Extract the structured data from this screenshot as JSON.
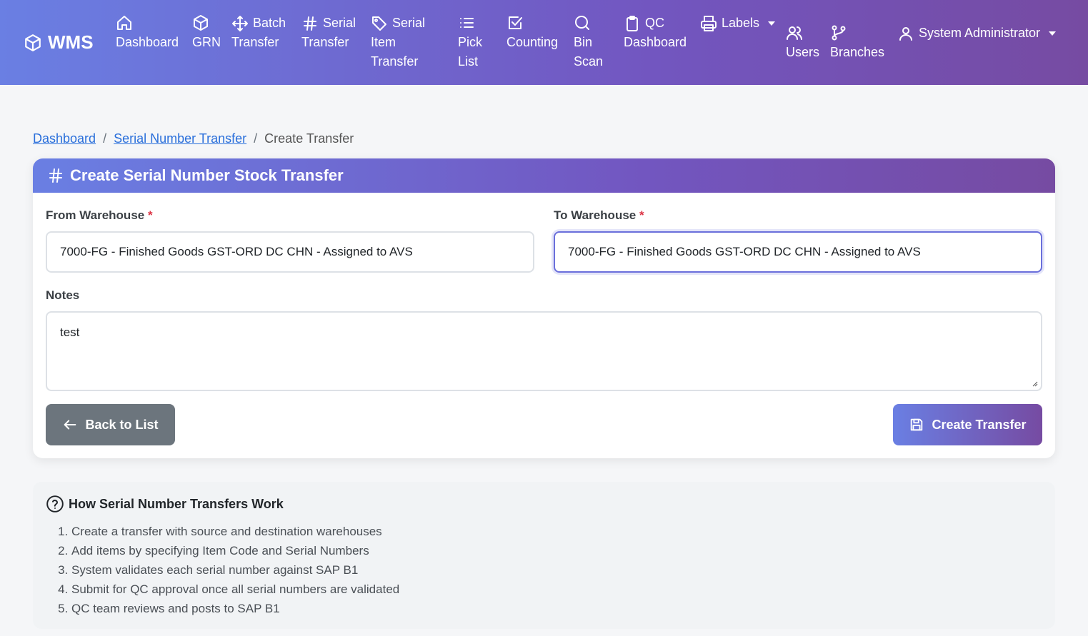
{
  "navbar": {
    "brand": "WMS",
    "items": [
      {
        "icon": "home-icon",
        "lines": [
          "Dashboard"
        ]
      },
      {
        "icon": "box-icon",
        "lines": [
          "GRN"
        ]
      },
      {
        "icon": "arrows-move-icon",
        "lines": [
          "Batch",
          "Transfer"
        ]
      },
      {
        "icon": "hash-icon",
        "lines": [
          "Serial",
          "Transfer"
        ]
      },
      {
        "icon": "tag-icon",
        "lines": [
          "Serial",
          "Item",
          "Transfer"
        ]
      },
      {
        "icon": "list-icon",
        "lines": [
          "Pick",
          "List"
        ]
      },
      {
        "icon": "check-square-icon",
        "lines": [
          "Counting"
        ]
      },
      {
        "icon": "search-icon",
        "lines": [
          "Bin",
          "Scan"
        ]
      },
      {
        "icon": "clipboard-icon",
        "lines": [
          "QC",
          "Dashboard"
        ]
      },
      {
        "icon": "printer-icon",
        "lines": [
          "Labels"
        ]
      },
      {
        "icon": "users-icon",
        "lines": [
          "Users"
        ]
      },
      {
        "icon": "branch-icon",
        "lines": [
          "Branches"
        ]
      }
    ],
    "user": "System Administrator"
  },
  "breadcrumb": {
    "home": "Dashboard",
    "parent": "Serial Number Transfer",
    "current": "Create Transfer",
    "separator": "/"
  },
  "form": {
    "title": "Create Serial Number Stock Transfer",
    "from_label": "From Warehouse",
    "from_value": "7000-FG - Finished Goods GST-ORD DC CHN - Assigned to AVS",
    "to_label": "To Warehouse",
    "to_value": "7000-FG - Finished Goods GST-ORD DC CHN - Assigned to AVS",
    "required_mark": "*",
    "notes_label": "Notes",
    "notes_value": "test",
    "back_button": "Back to List",
    "create_button": "Create Transfer"
  },
  "help": {
    "title": "How Serial Number Transfers Work",
    "steps": [
      "Create a transfer with source and destination warehouses",
      "Add items by specifying Item Code and Serial Numbers",
      "System validates each serial number against SAP B1",
      "Submit for QC approval once all serial numbers are validated",
      "QC team reviews and posts to SAP B1"
    ]
  },
  "colors": {
    "gradient_start": "#6a7fe3",
    "gradient_end": "#764ba2",
    "link": "#2a6fdb",
    "required": "#dc3545",
    "secondary_button": "#6c757d"
  }
}
